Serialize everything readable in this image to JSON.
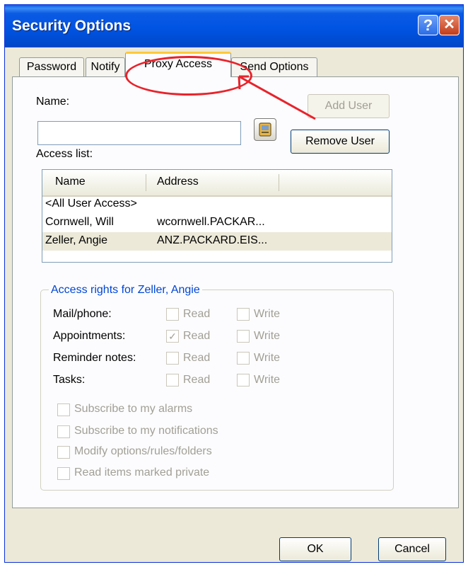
{
  "window": {
    "title": "Security Options",
    "help_glyph": "?",
    "close_glyph": "✕"
  },
  "tabs": [
    {
      "label": "Password"
    },
    {
      "label": "Notify"
    },
    {
      "label": "Proxy Access"
    },
    {
      "label": "Send Options"
    }
  ],
  "active_tab": "Proxy Access",
  "proxy": {
    "name_label": "Name:",
    "name_value": "",
    "add_user": "Add User",
    "remove_user": "Remove User",
    "access_list_label": "Access list:",
    "columns": [
      "Name",
      "Address"
    ],
    "rows": [
      {
        "name": "<All User Access>",
        "address": ""
      },
      {
        "name": "Cornwell, Will",
        "address": "wcornwell.PACKAR..."
      },
      {
        "name": "Zeller, Angie",
        "address": "ANZ.PACKARD.EIS..."
      }
    ],
    "selected_row": "Zeller, Angie"
  },
  "rights": {
    "title": "Access rights for Zeller, Angie",
    "read_label": "Read",
    "write_label": "Write",
    "rows": [
      {
        "label": "Mail/phone:",
        "read": false,
        "write": false
      },
      {
        "label": "Appointments:",
        "read": true,
        "write": false
      },
      {
        "label": "Reminder notes:",
        "read": false,
        "write": false
      },
      {
        "label": "Tasks:",
        "read": false,
        "write": false
      }
    ],
    "options": [
      {
        "label": "Subscribe to my alarms",
        "checked": false
      },
      {
        "label": "Subscribe to my notifications",
        "checked": false
      },
      {
        "label": "Modify options/rules/folders",
        "checked": false
      },
      {
        "label": "Read items marked private",
        "checked": false
      }
    ]
  },
  "footer": {
    "ok": "OK",
    "cancel": "Cancel"
  },
  "annotation_color": "#e8232b"
}
